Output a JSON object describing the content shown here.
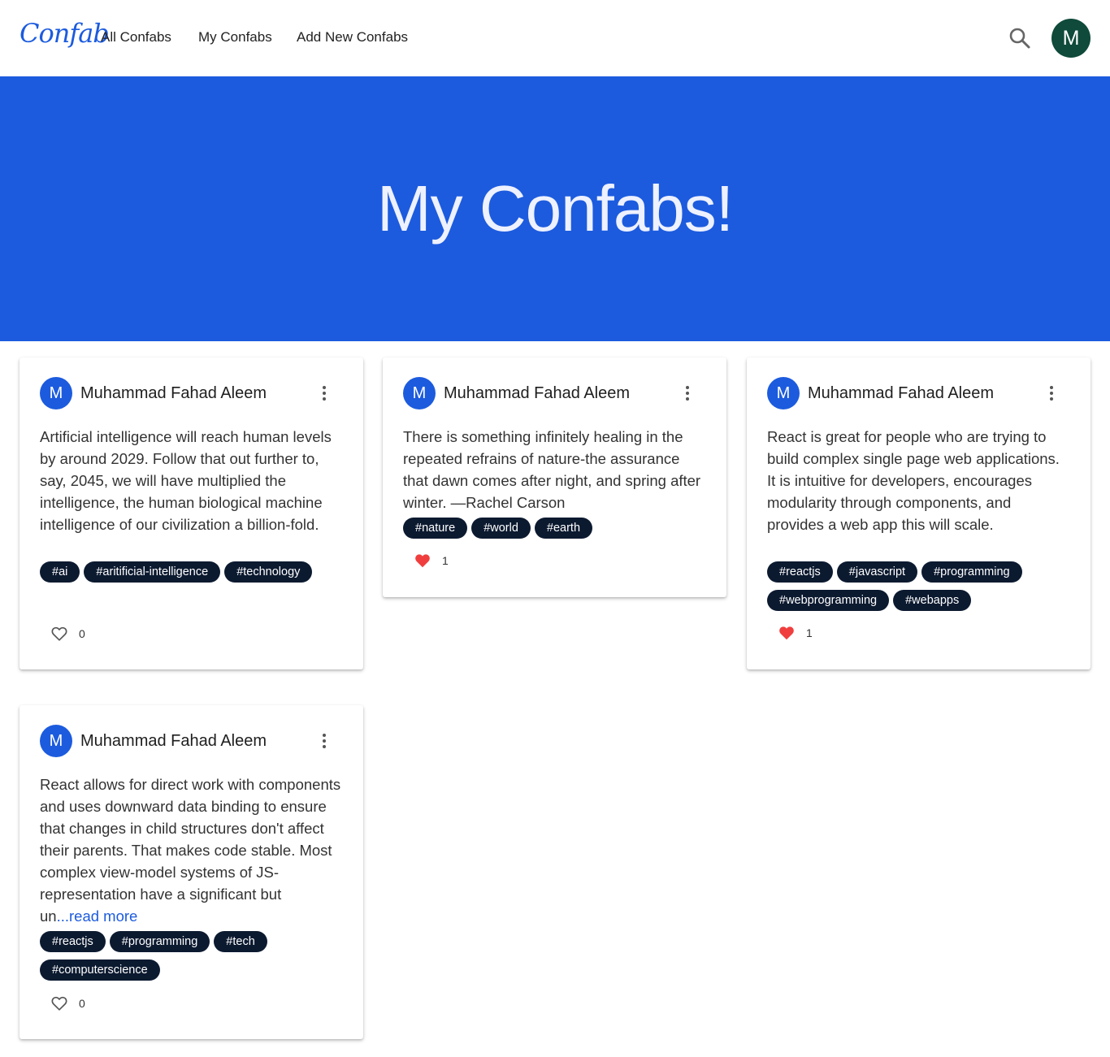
{
  "nav": {
    "logo": "Confab",
    "links": [
      "All Confabs",
      "My Confabs",
      "Add New Confabs"
    ],
    "user_initial": "M"
  },
  "hero": {
    "title": "My Confabs!"
  },
  "colors": {
    "primary": "#1c5bde",
    "tag_bg": "#0c1a30",
    "liked": "#f03e3e",
    "user_avatar": "#0f4a3a"
  },
  "cards": [
    {
      "initial": "M",
      "author": "Muhammad Fahad Aleem",
      "text": "Artificial intelligence will reach human levels by around 2029. Follow that out further to, say, 2045, we will have multiplied the intelligence, the human biological machine intelligence of our civilization a billion-fold.",
      "read_more": "",
      "tags": [
        "#ai",
        "#aritificial-intelligence",
        "#technology"
      ],
      "likes": "0",
      "liked": false
    },
    {
      "initial": "M",
      "author": "Muhammad Fahad Aleem",
      "text": "There is something infinitely healing in the repeated refrains of nature-the assurance that dawn comes after night, and spring after winter. —Rachel Carson",
      "read_more": "",
      "tags": [
        "#nature",
        "#world",
        "#earth"
      ],
      "likes": "1",
      "liked": true
    },
    {
      "initial": "M",
      "author": "Muhammad Fahad Aleem",
      "text": "React is great for people who are trying to build complex single page web applications. It is intuitive for developers, encourages modularity through components, and provides a web app this will scale.",
      "read_more": "",
      "tags": [
        "#reactjs",
        "#javascript",
        "#programming",
        "#webprogramming",
        "#webapps"
      ],
      "likes": "1",
      "liked": true
    },
    {
      "initial": "M",
      "author": "Muhammad Fahad Aleem",
      "text": "React allows for direct work with components and uses downward data binding to ensure that changes in child structures don't affect their parents. That makes code stable. Most complex view-model systems of JS-representation have a significant but un",
      "read_more": "...read more",
      "tags": [
        "#reactjs",
        "#programming",
        "#tech",
        "#computerscience"
      ],
      "likes": "0",
      "liked": false
    }
  ]
}
